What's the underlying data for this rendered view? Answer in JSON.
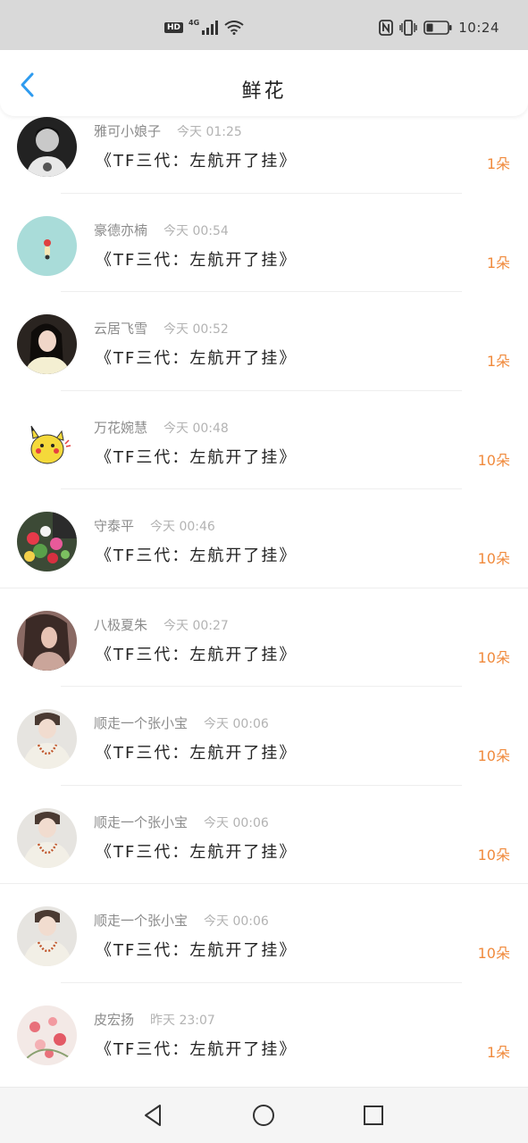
{
  "status_bar": {
    "network_type": "4G",
    "time": "10:24",
    "icons": [
      "hd-icon",
      "signal-icon",
      "wifi-icon",
      "nfc-icon",
      "vibrate-icon",
      "battery-icon"
    ]
  },
  "header": {
    "title": "鲜花",
    "back_icon": "chevron-left-icon"
  },
  "colors": {
    "accent_blue": "#2e9bef",
    "count_orange": "#f08a3c",
    "name_gray": "#8c8c8c",
    "time_gray": "#b3b3b3"
  },
  "rows": [
    {
      "name": "雅可小娘子",
      "time": "今天 01:25",
      "gift": "《TF三代：左航开了挂》",
      "count": "1朵",
      "avatar": "avatar-dark-photo"
    },
    {
      "name": "豪德亦楠",
      "time": "今天 00:54",
      "gift": "《TF三代：左航开了挂》",
      "count": "1朵",
      "avatar": "avatar-teal-illustration"
    },
    {
      "name": "云居飞雪",
      "time": "今天 00:52",
      "gift": "《TF三代：左航开了挂》",
      "count": "1朵",
      "avatar": "avatar-girl-photo"
    },
    {
      "name": "万花婉慧",
      "time": "今天 00:48",
      "gift": "《TF三代：左航开了挂》",
      "count": "10朵",
      "avatar": "avatar-pikachu"
    },
    {
      "name": "守泰平",
      "time": "今天 00:46",
      "gift": "《TF三代：左航开了挂》",
      "count": "10朵",
      "avatar": "avatar-flowers"
    },
    {
      "name": "八极夏朱",
      "time": "今天 00:27",
      "gift": "《TF三代：左航开了挂》",
      "count": "10朵",
      "avatar": "avatar-portrait"
    },
    {
      "name": "顺走一个张小宝",
      "time": "今天 00:06",
      "gift": "《TF三代：左航开了挂》",
      "count": "10朵",
      "avatar": "avatar-boy-photo"
    },
    {
      "name": "顺走一个张小宝",
      "time": "今天 00:06",
      "gift": "《TF三代：左航开了挂》",
      "count": "10朵",
      "avatar": "avatar-boy-photo"
    },
    {
      "name": "顺走一个张小宝",
      "time": "今天 00:06",
      "gift": "《TF三代：左航开了挂》",
      "count": "10朵",
      "avatar": "avatar-boy-photo"
    },
    {
      "name": "皮宏扬",
      "time": "昨天 23:07",
      "gift": "《TF三代：左航开了挂》",
      "count": "1朵",
      "avatar": "avatar-pink-flowers"
    }
  ],
  "nav_bar": {
    "buttons": [
      "back-triangle-icon",
      "home-circle-icon",
      "recents-square-icon"
    ]
  }
}
